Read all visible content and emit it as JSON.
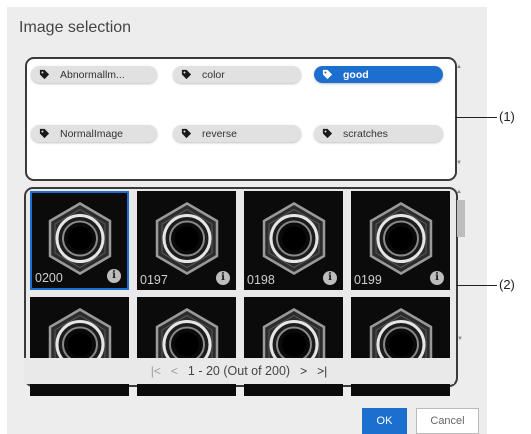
{
  "dialog": {
    "title": "Image selection"
  },
  "tags": [
    {
      "label": "Abnormallm...",
      "active": false
    },
    {
      "label": "color",
      "active": false
    },
    {
      "label": "good",
      "active": true
    },
    {
      "label": "NormalImage",
      "active": false
    },
    {
      "label": "reverse",
      "active": false
    },
    {
      "label": "scratches",
      "active": false
    }
  ],
  "thumbnails": [
    {
      "caption": "0200",
      "selected": true
    },
    {
      "caption": "0197",
      "selected": false
    },
    {
      "caption": "0198",
      "selected": false
    },
    {
      "caption": "0199",
      "selected": false
    },
    {
      "caption": "",
      "selected": false
    },
    {
      "caption": "",
      "selected": false
    },
    {
      "caption": "",
      "selected": false
    },
    {
      "caption": "",
      "selected": false
    }
  ],
  "info_glyph": "i",
  "pager": {
    "first": "|<",
    "prev": "<",
    "range": "1 - 20 (Out of 200)",
    "next": ">",
    "last": ">|"
  },
  "callouts": {
    "tags_region": "(1)",
    "images_region": "(2)"
  },
  "buttons": {
    "ok": "OK",
    "cancel": "Cancel"
  },
  "icons": {
    "tag": "tag-icon",
    "info": "info-icon"
  },
  "colors": {
    "accent": "#1d6fcf",
    "frame": "#3a3a3a",
    "dialog_bg": "#ededed"
  }
}
